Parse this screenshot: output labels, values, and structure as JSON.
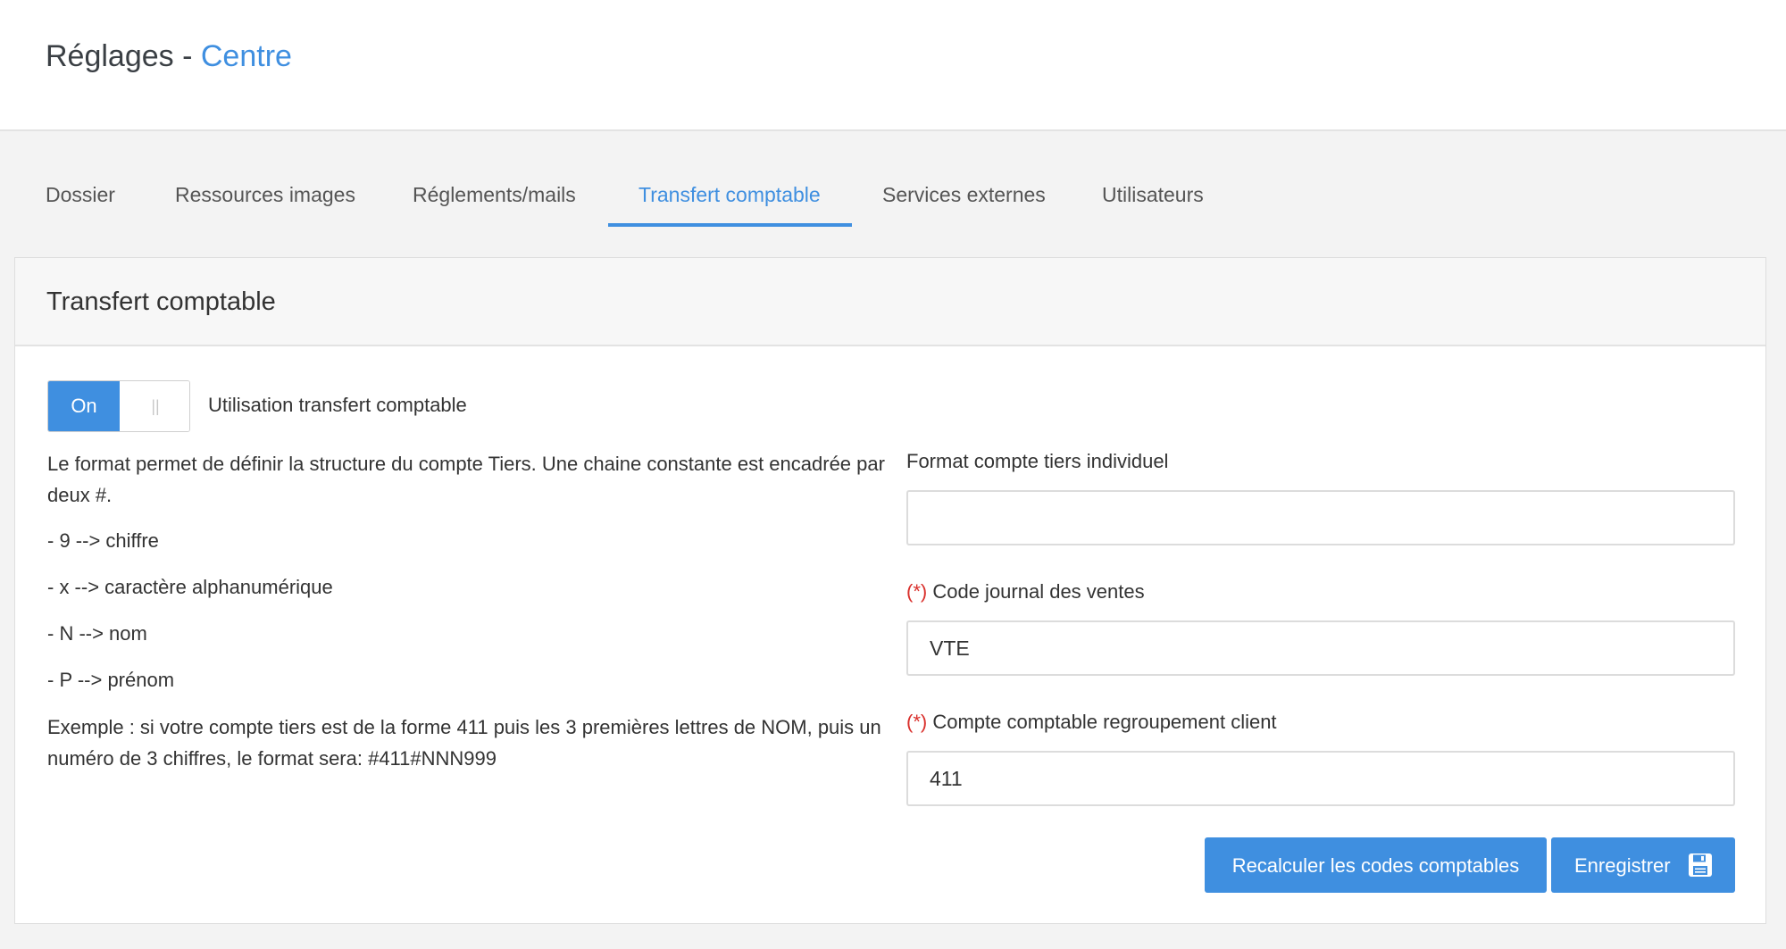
{
  "header": {
    "title": "Réglages",
    "separator": " - ",
    "context": "Centre"
  },
  "tabs": [
    {
      "label": "Dossier",
      "active": false
    },
    {
      "label": "Ressources images",
      "active": false
    },
    {
      "label": "Réglements/mails",
      "active": false
    },
    {
      "label": "Transfert comptable",
      "active": true
    },
    {
      "label": "Services externes",
      "active": false
    },
    {
      "label": "Utilisateurs",
      "active": false
    }
  ],
  "panel": {
    "title": "Transfert comptable",
    "toggle": {
      "on_label": "On",
      "handle_glyph": "||",
      "state": "on",
      "label": "Utilisation transfert comptable"
    },
    "help": {
      "intro": "Le format permet de définir la structure du compte Tiers. Une chaine constante est encadrée par deux #.",
      "rules": [
        "- 9 --> chiffre",
        "- x --> caractère alphanumérique",
        "- N --> nom",
        "- P --> prénom"
      ],
      "example": "Exemple : si votre compte tiers est de la forme 411 puis les 3 premières lettres de NOM, puis un numéro de 3 chiffres, le format sera: #411#NNN999"
    },
    "fields": {
      "format_tiers": {
        "label": "Format compte tiers individuel",
        "value": ""
      },
      "code_journal": {
        "required_mark": "(*)",
        "label": "Code journal des ventes",
        "value": "VTE"
      },
      "compte_regroupement": {
        "required_mark": "(*)",
        "label": "Compte comptable regroupement client",
        "value": "411"
      }
    },
    "buttons": {
      "recalc": "Recalculer les codes comptables",
      "save": "Enregistrer",
      "save_icon": "floppy-disk-icon"
    }
  },
  "colors": {
    "accent": "#3f8fe0",
    "required": "#d9302c",
    "background": "#f3f3f3"
  }
}
